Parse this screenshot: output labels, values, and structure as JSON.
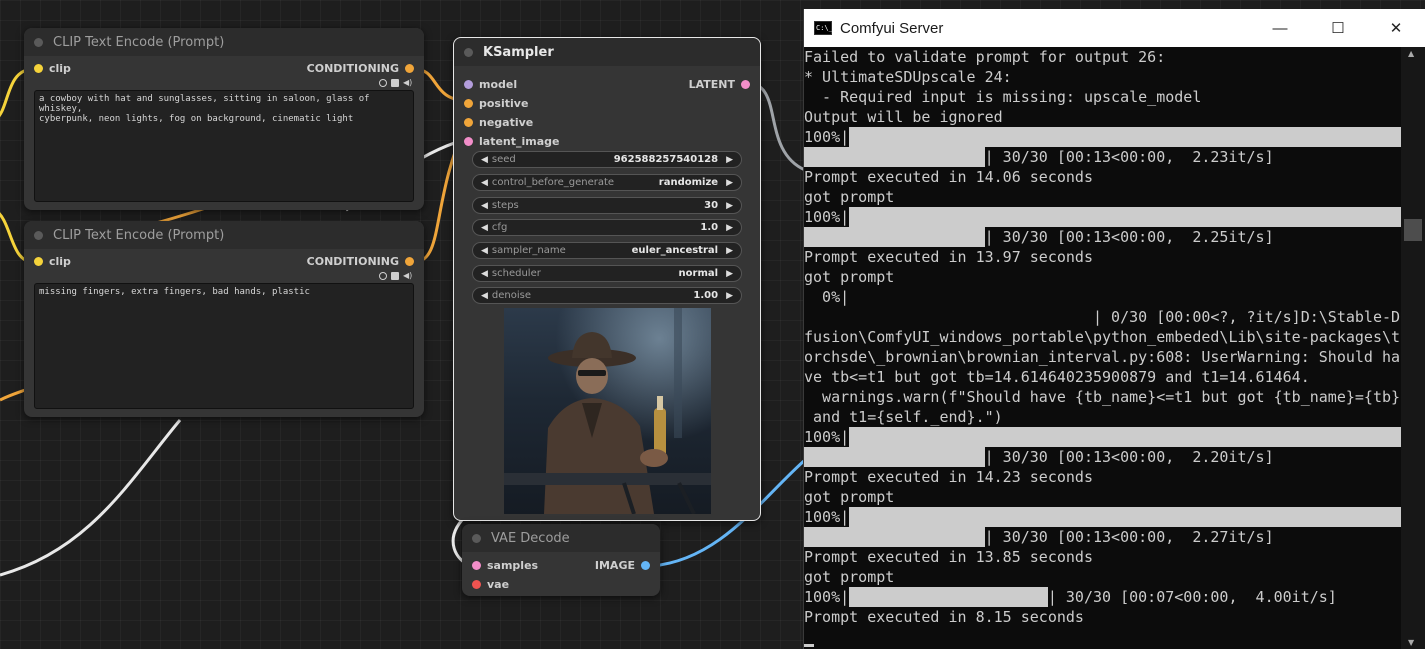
{
  "colors": {
    "clip": "#f5d33b",
    "conditioning": "#f0a53a",
    "latent": "#f28ec9",
    "model": "#b39ddb",
    "image": "#64b5f6",
    "vae": "#ef5350"
  },
  "clip_node_1": {
    "title": "CLIP Text Encode (Prompt)",
    "input_label": "clip",
    "output_label": "CONDITIONING",
    "text": "a cowboy with hat and sunglasses, sitting in saloon, glass of whiskey,\ncyberpunk, neon lights, fog on background, cinematic light"
  },
  "clip_node_2": {
    "title": "CLIP Text Encode (Prompt)",
    "input_label": "clip",
    "output_label": "CONDITIONING",
    "text": "missing fingers, extra fingers, bad hands, plastic"
  },
  "ksampler": {
    "title": "KSampler",
    "inputs": [
      "model",
      "positive",
      "negative",
      "latent_image"
    ],
    "output_label": "LATENT",
    "widgets": [
      {
        "label": "seed",
        "value": "962588257540128"
      },
      {
        "label": "control_before_generate",
        "value": "randomize"
      },
      {
        "label": "steps",
        "value": "30"
      },
      {
        "label": "cfg",
        "value": "1.0"
      },
      {
        "label": "sampler_name",
        "value": "euler_ancestral"
      },
      {
        "label": "scheduler",
        "value": "normal"
      },
      {
        "label": "denoise",
        "value": "1.00"
      }
    ]
  },
  "vae_decode": {
    "title": "VAE Decode",
    "inputs": [
      "samples",
      "vae"
    ],
    "output_label": "IMAGE"
  },
  "console": {
    "title": "Comfyui Server",
    "lines": [
      {
        "text": "Failed to validate prompt for output 26:"
      },
      {
        "text": "* UltimateSDUpscale 24:"
      },
      {
        "text": "  - Required input is missing: upscale_model"
      },
      {
        "text": "Output will be ignored"
      },
      {
        "text": "100%|",
        "bar": 1
      },
      {
        "text": "                    | 30/30 [00:13<00:00,  2.23it/s]",
        "bar": 1,
        "bar_from_start": true
      },
      {
        "text": "Prompt executed in 14.06 seconds"
      },
      {
        "text": "got prompt"
      },
      {
        "text": "100%|",
        "bar": 1
      },
      {
        "text": "                    | 30/30 [00:13<00:00,  2.25it/s]",
        "bar": 1,
        "bar_from_start": true
      },
      {
        "text": "Prompt executed in 13.97 seconds"
      },
      {
        "text": "got prompt"
      },
      {
        "text": "  0%|"
      },
      {
        "text": "                                | 0/30 [00:00<?, ?it/s]D:\\Stable-Dif"
      },
      {
        "text": "fusion\\ComfyUI_windows_portable\\python_embeded\\Lib\\site-packages\\t"
      },
      {
        "text": "orchsde\\_brownian\\brownian_interval.py:608: UserWarning: Should ha"
      },
      {
        "text": "ve tb<=t1 but got tb=14.614640235900879 and t1=14.61464."
      },
      {
        "text": "  warnings.warn(f\"Should have {tb_name}<=t1 but got {tb_name}={tb}"
      },
      {
        "text": " and t1={self._end}.\")"
      },
      {
        "text": "100%|",
        "bar": 1
      },
      {
        "text": "                    | 30/30 [00:13<00:00,  2.20it/s]",
        "bar": 1,
        "bar_from_start": true
      },
      {
        "text": "Prompt executed in 14.23 seconds"
      },
      {
        "text": "got prompt"
      },
      {
        "text": "100%|",
        "bar": 1
      },
      {
        "text": "                    | 30/30 [00:13<00:00,  2.27it/s]",
        "bar": 1,
        "bar_from_start": true
      },
      {
        "text": "Prompt executed in 13.85 seconds"
      },
      {
        "text": "got prompt"
      },
      {
        "text": "100%|                      | 30/30 [00:07<00:00,  4.00it/s]",
        "bar": 1,
        "inline_bar": true
      },
      {
        "text": "Prompt executed in 8.15 seconds"
      }
    ]
  }
}
